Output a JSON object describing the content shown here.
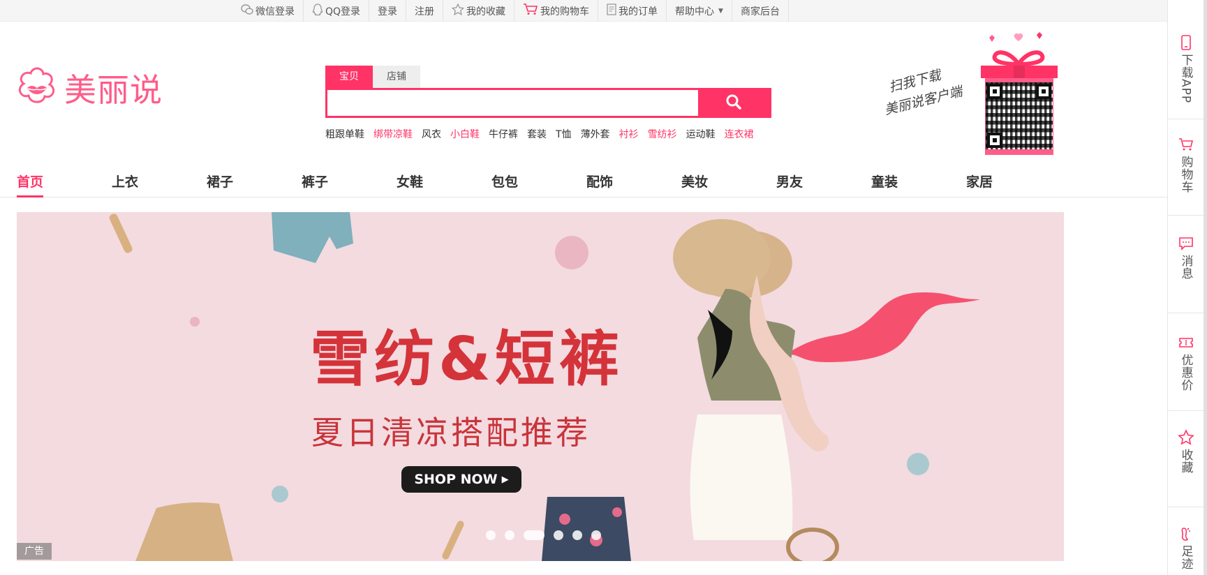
{
  "topbar": {
    "items": [
      {
        "label": "微信登录",
        "icon": "wechat-icon"
      },
      {
        "label": "QQ登录",
        "icon": "qq-icon"
      },
      {
        "label": "登录"
      },
      {
        "label": "注册"
      },
      {
        "label": "我的收藏",
        "icon": "star-icon"
      },
      {
        "label": "我的购物车",
        "icon": "cart-icon"
      },
      {
        "label": "我的订单",
        "icon": "order-icon"
      },
      {
        "label": "帮助中心",
        "icon": "caret-down-icon"
      },
      {
        "label": "商家后台"
      }
    ]
  },
  "logo": {
    "text": "美丽说",
    "icon": "flower-lips-logo-icon"
  },
  "search": {
    "tabs": [
      "宝贝",
      "店铺"
    ],
    "active_tab": "宝贝",
    "value": "",
    "placeholder": "",
    "button_icon": "search-icon",
    "hot_words": [
      {
        "label": "粗跟单鞋",
        "highlight": false
      },
      {
        "label": "绑带凉鞋",
        "highlight": true
      },
      {
        "label": "风衣",
        "highlight": false
      },
      {
        "label": "小白鞋",
        "highlight": true
      },
      {
        "label": "牛仔裤",
        "highlight": false
      },
      {
        "label": "套装",
        "highlight": false
      },
      {
        "label": "T恤",
        "highlight": false
      },
      {
        "label": "薄外套",
        "highlight": false
      },
      {
        "label": "衬衫",
        "highlight": true
      },
      {
        "label": "雪纺衫",
        "highlight": true
      },
      {
        "label": "运动鞋",
        "highlight": false
      },
      {
        "label": "连衣裙",
        "highlight": true
      }
    ]
  },
  "promo": {
    "line1": "扫我下载",
    "line2": "美丽说客户端",
    "qr_icon": "qr-code-icon",
    "gift_icon": "gift-box-icon"
  },
  "categories": [
    "首页",
    "上衣",
    "裙子",
    "裤子",
    "女鞋",
    "包包",
    "配饰",
    "美妆",
    "男友",
    "童装",
    "家居"
  ],
  "active_category": "首页",
  "banner": {
    "title": "雪纺&短裤",
    "subtitle": "夏日清凉搭配推荐",
    "cta": "SHOP NOW",
    "ad_tag": "广告",
    "slide_count": 6,
    "active_slide": 3
  },
  "sidebar": [
    {
      "label": "下载APP",
      "icon": "phone-icon"
    },
    {
      "label": "购物车",
      "icon": "cart-icon"
    },
    {
      "label": "消息",
      "icon": "message-icon"
    },
    {
      "label": "优惠价",
      "icon": "coupon-icon"
    },
    {
      "label": "收藏",
      "icon": "star-icon"
    },
    {
      "label": "足迹",
      "icon": "footprint-icon"
    }
  ],
  "colors": {
    "brand": "#ff3366",
    "logo": "#ff5c8a",
    "banner_bg": "#f3dbe0",
    "banner_title": "#d4333a"
  }
}
